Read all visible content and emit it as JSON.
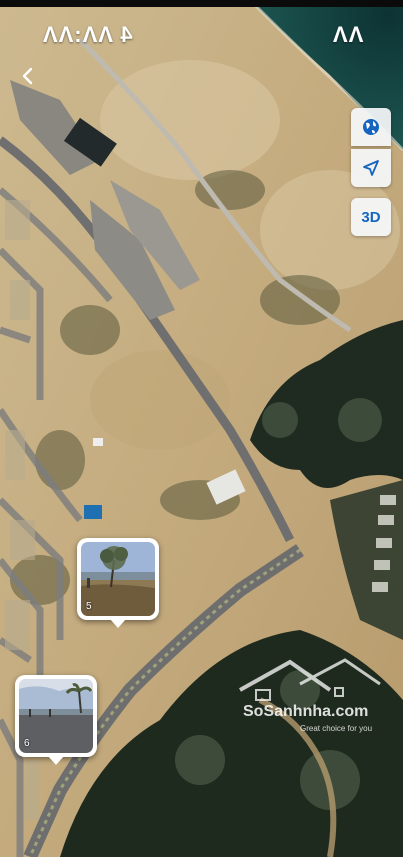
{
  "status_bar": {
    "left_text": "4 ΛΛ:ΛΛ",
    "right_text": "ΛΛ"
  },
  "map_controls": {
    "globe_icon": "globe-icon",
    "locate_icon": "navigation-arrow-icon",
    "three_d_label": "3D"
  },
  "photo_markers": [
    {
      "number": "5"
    },
    {
      "number": "6"
    }
  ],
  "watermark": {
    "brand": "SoSanhnha.com",
    "tagline": "Great choice for you"
  },
  "colors": {
    "sand": "#c9b48c",
    "sea": "#0f3b3a",
    "button_accent": "#1565c0"
  }
}
